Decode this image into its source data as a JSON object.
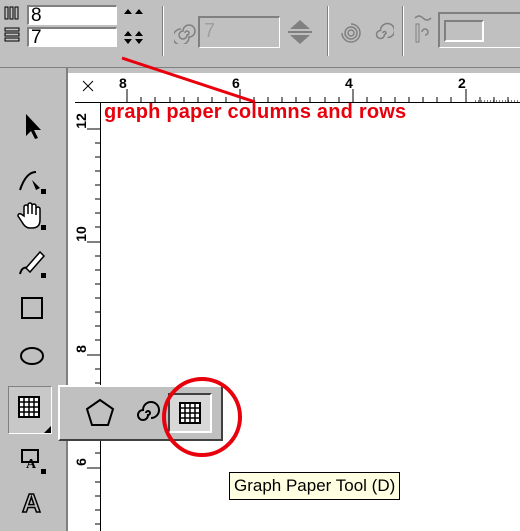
{
  "property_bar": {
    "columns_value": "8",
    "rows_value": "7",
    "spiral_revolutions_value": "7",
    "columns_icon": "graph-columns-icon",
    "rows_icon": "graph-rows-icon",
    "spiral_icon": "spiral-icon",
    "symmetric_spiral_icon": "symmetric-spiral-icon",
    "logarithmic_spiral_icon": "logarithmic-spiral-icon",
    "expansion_icon": "spiral-expansion-icon"
  },
  "ruler": {
    "horizontal_labels": [
      "8",
      "6",
      "4",
      "2"
    ],
    "vertical_labels": [
      "12",
      "10",
      "8",
      "6"
    ]
  },
  "toolbox": {
    "tools": [
      {
        "name": "pick-tool",
        "icon": "arrow-pointer-icon"
      },
      {
        "name": "shape-tool",
        "icon": "shape-node-icon"
      },
      {
        "name": "zoom-tool",
        "icon": "hand-icon"
      },
      {
        "name": "freehand-tool",
        "icon": "pen-icon"
      },
      {
        "name": "rectangle-tool",
        "icon": "rectangle-icon"
      },
      {
        "name": "ellipse-tool",
        "icon": "ellipse-icon"
      },
      {
        "name": "graph-paper-tool",
        "icon": "grid-icon",
        "active": true
      },
      {
        "name": "text-tool",
        "icon": "text-icon"
      },
      {
        "name": "outline-tool",
        "icon": "letter-a-icon"
      }
    ],
    "flyout": [
      {
        "name": "polygon-tool",
        "icon": "pentagon-icon"
      },
      {
        "name": "spiral-tool",
        "icon": "spiral-icon"
      },
      {
        "name": "graph-paper-tool",
        "icon": "grid-icon",
        "pressed": true
      }
    ]
  },
  "annotation": {
    "label": "graph paper columns and rows",
    "color": "#e8000d"
  },
  "tooltip": {
    "text": "Graph Paper Tool (D)"
  }
}
